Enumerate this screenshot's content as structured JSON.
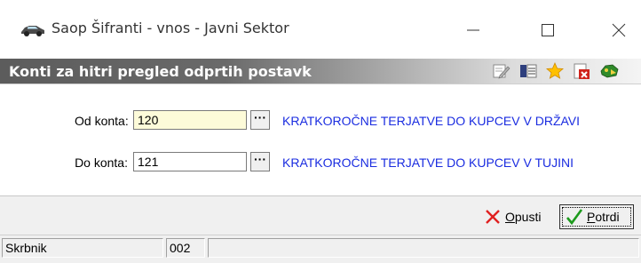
{
  "window": {
    "title": "Saop Šifranti - vnos - Javni Sektor",
    "app_icon": "car-icon",
    "controls": [
      "minimize-icon",
      "maximize-icon",
      "close-icon"
    ]
  },
  "header": {
    "title": "Konti za hitri pregled odprtih postavk",
    "toolbar_icons": [
      "edit-icon",
      "list-icon",
      "star-icon",
      "delete-icon",
      "exit-icon"
    ]
  },
  "form": {
    "from_account": {
      "label": "Od konta:",
      "value": "120",
      "lookup": "···",
      "description": "KRATKOROČNE TERJATVE DO KUPCEV V DRŽAVI"
    },
    "to_account": {
      "label": "Do konta:",
      "value": "121",
      "lookup": "···",
      "description": "KRATKOROČNE TERJATVE DO KUPCEV V TUJINI"
    }
  },
  "buttons": {
    "cancel": {
      "label_prefix": "O",
      "label_rest": "pusti",
      "icon": "x-icon"
    },
    "confirm": {
      "label_prefix": "P",
      "label_rest": "otrdi",
      "icon": "checkmark-icon"
    }
  },
  "statusbar": {
    "user": "Skrbnik",
    "code": "002",
    "message": ""
  },
  "colors": {
    "description_text": "#1a2ce0",
    "field_highlight": "#fdfbd9",
    "header_gradient_start": "#5c5c5c",
    "header_gradient_end": "#f4f4f4"
  }
}
